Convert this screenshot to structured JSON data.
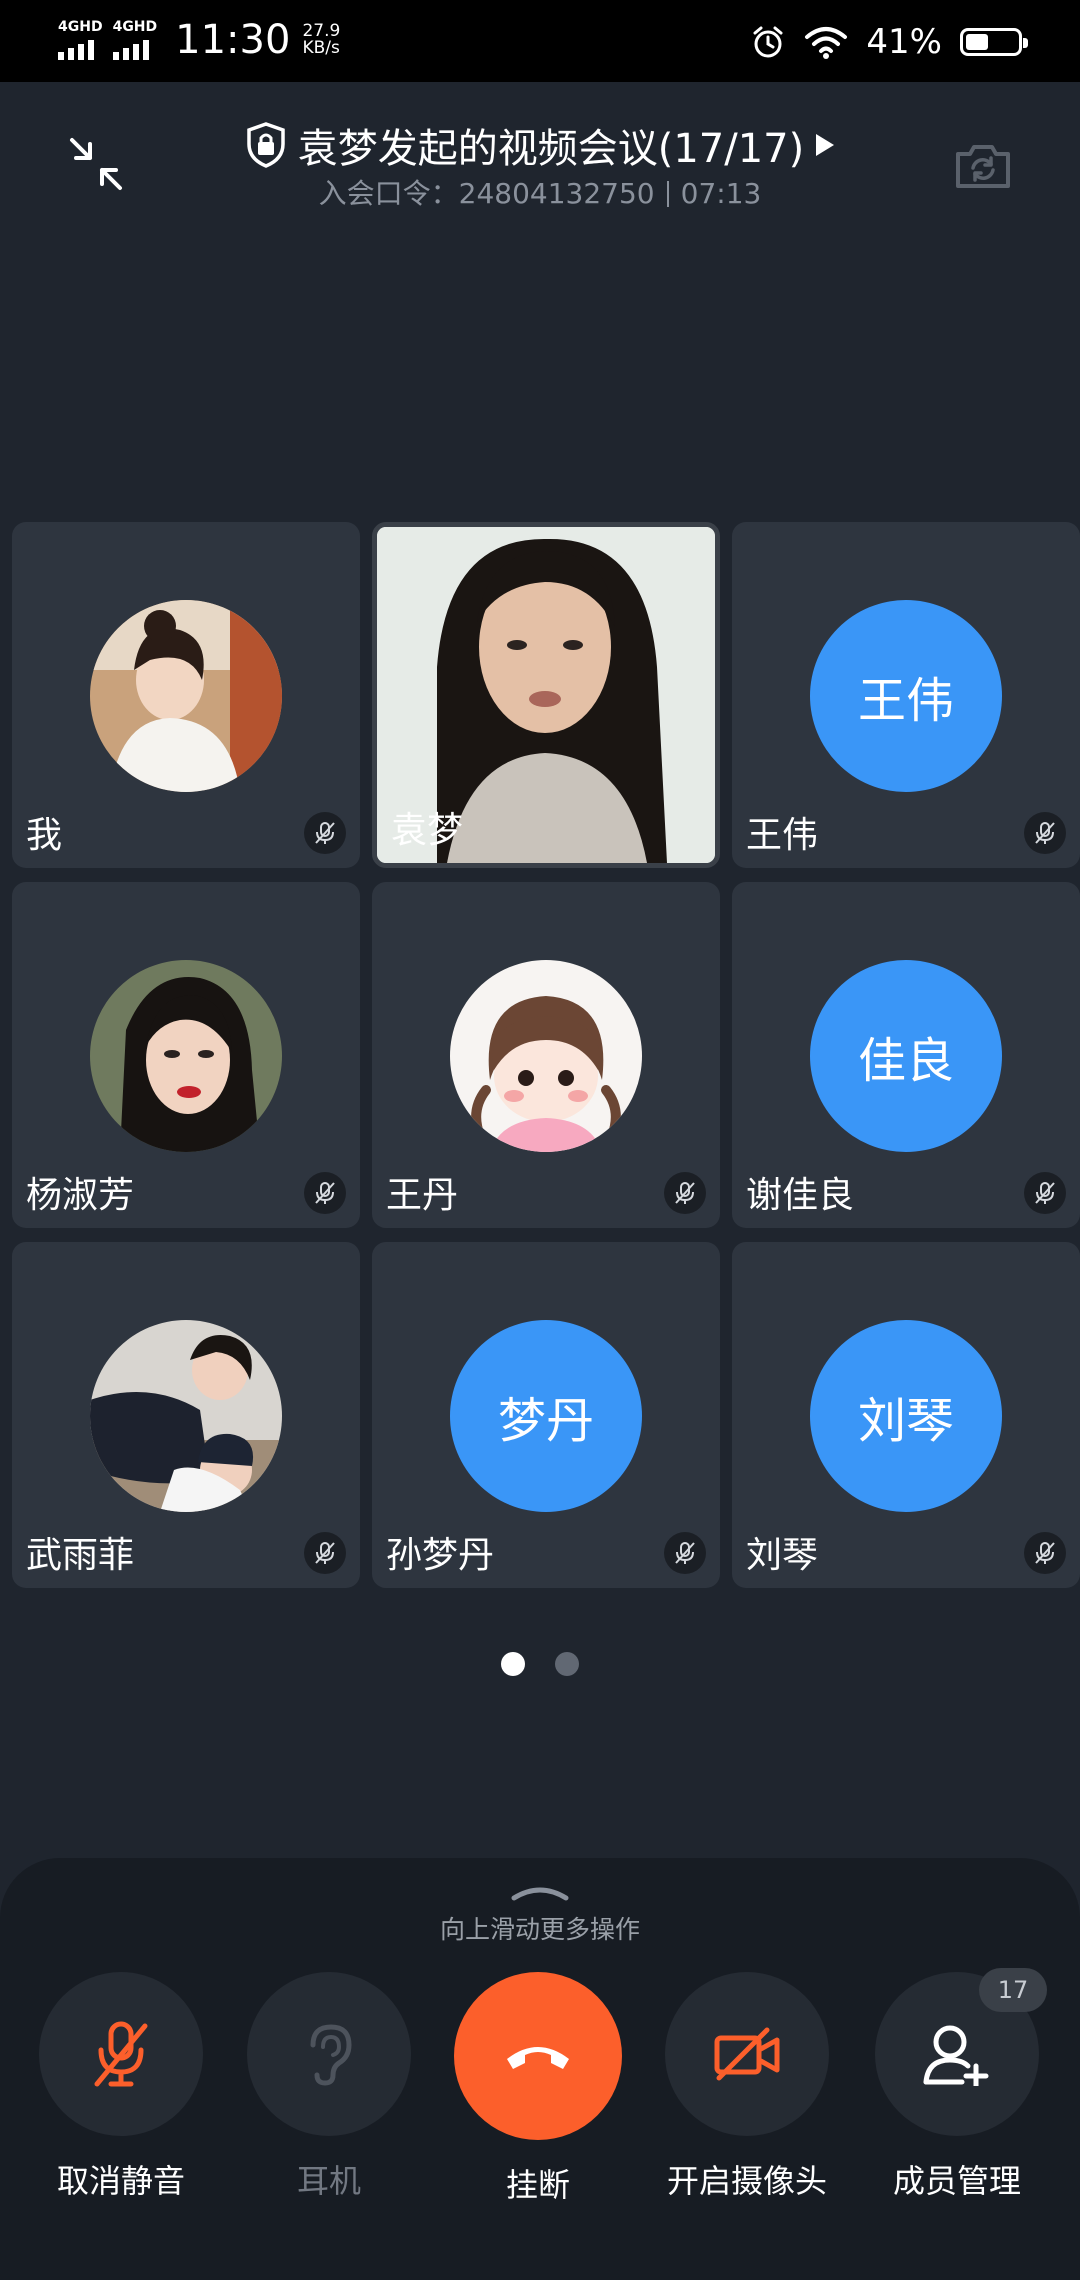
{
  "status_bar": {
    "network1": "4GHD",
    "network2": "4GHD",
    "time": "11:30",
    "speed_value": "27.9",
    "speed_unit": "KB/s",
    "battery_text": "41%",
    "battery_level": 0.41
  },
  "header": {
    "title": "袁梦发起的视频会议(17/17)",
    "meeting_code_label": "入会口令：24804132750",
    "duration": "07:13"
  },
  "participants": [
    {
      "name": "我",
      "avatar_type": "photo",
      "muted": true
    },
    {
      "name": "袁梦",
      "avatar_type": "video",
      "muted": false
    },
    {
      "name": "王伟",
      "avatar_type": "text",
      "avatar_text": "王伟",
      "muted": true
    },
    {
      "name": "杨淑芳",
      "avatar_type": "photo",
      "muted": true
    },
    {
      "name": "王丹",
      "avatar_type": "photo",
      "muted": true
    },
    {
      "name": "谢佳良",
      "avatar_type": "text",
      "avatar_text": "佳良",
      "muted": true
    },
    {
      "name": "武雨菲",
      "avatar_type": "photo",
      "muted": true
    },
    {
      "name": "孙梦丹",
      "avatar_type": "text",
      "avatar_text": "梦丹",
      "muted": true
    },
    {
      "name": "刘琴",
      "avatar_type": "text",
      "avatar_text": "刘琴",
      "muted": true
    }
  ],
  "pagination": {
    "total": 2,
    "current": 1
  },
  "panel": {
    "hint": "向上滑动更多操作",
    "controls": {
      "unmute": "取消静音",
      "earpiece": "耳机",
      "hangup": "挂断",
      "camera": "开启摄像头",
      "members": "成员管理",
      "members_badge": "17"
    }
  },
  "colors": {
    "accent_blue": "#3a96f7",
    "hangup_orange": "#fc5f2b",
    "background": "#1f252e",
    "tile": "#2e353f"
  }
}
